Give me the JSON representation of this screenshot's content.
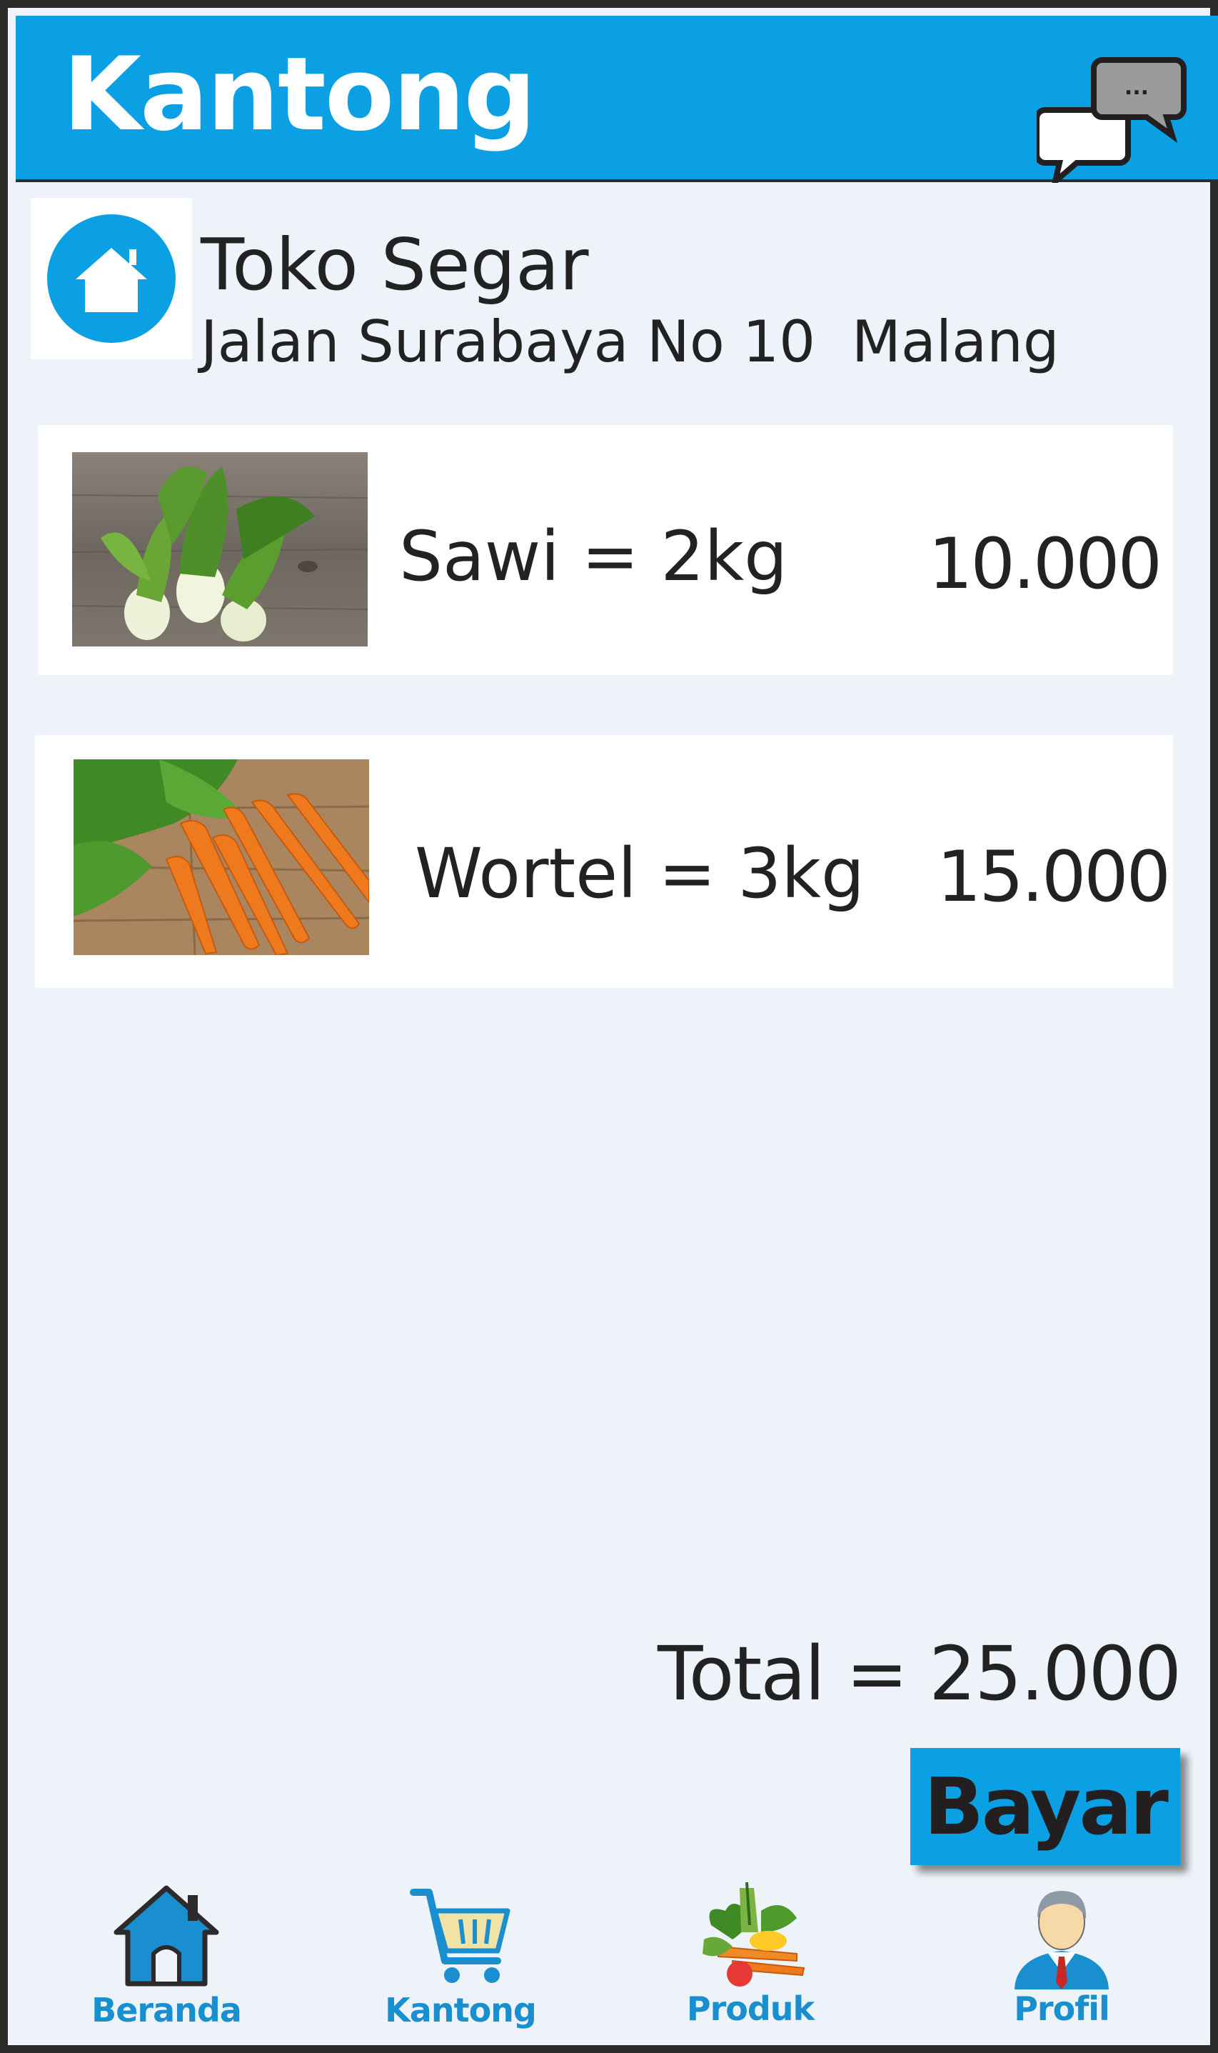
{
  "header": {
    "title": "Kantong",
    "chat_icon": "chat-bubbles-icon",
    "chat_dots": "..."
  },
  "store": {
    "name": "Toko Segar",
    "address": "Jalan Surabaya No 10  Malang",
    "icon": "home-icon"
  },
  "items": [
    {
      "name": "Sawi = 2kg",
      "price": "10.000",
      "image": "bok-choy-photo"
    },
    {
      "name": "Wortel = 3kg",
      "price": "15.000",
      "image": "carrots-photo"
    }
  ],
  "total_label": "Total = 25.000",
  "pay_button": "Bayar",
  "nav": [
    {
      "label": "Beranda",
      "icon": "home-icon"
    },
    {
      "label": "Kantong",
      "icon": "cart-icon"
    },
    {
      "label": "Produk",
      "icon": "vegetables-icon"
    },
    {
      "label": "Profil",
      "icon": "user-icon"
    }
  ],
  "colors": {
    "accent": "#0aa0e3",
    "nav_text": "#1a8fd0",
    "background": "#eef3f9",
    "border": "#2d2a2b"
  }
}
